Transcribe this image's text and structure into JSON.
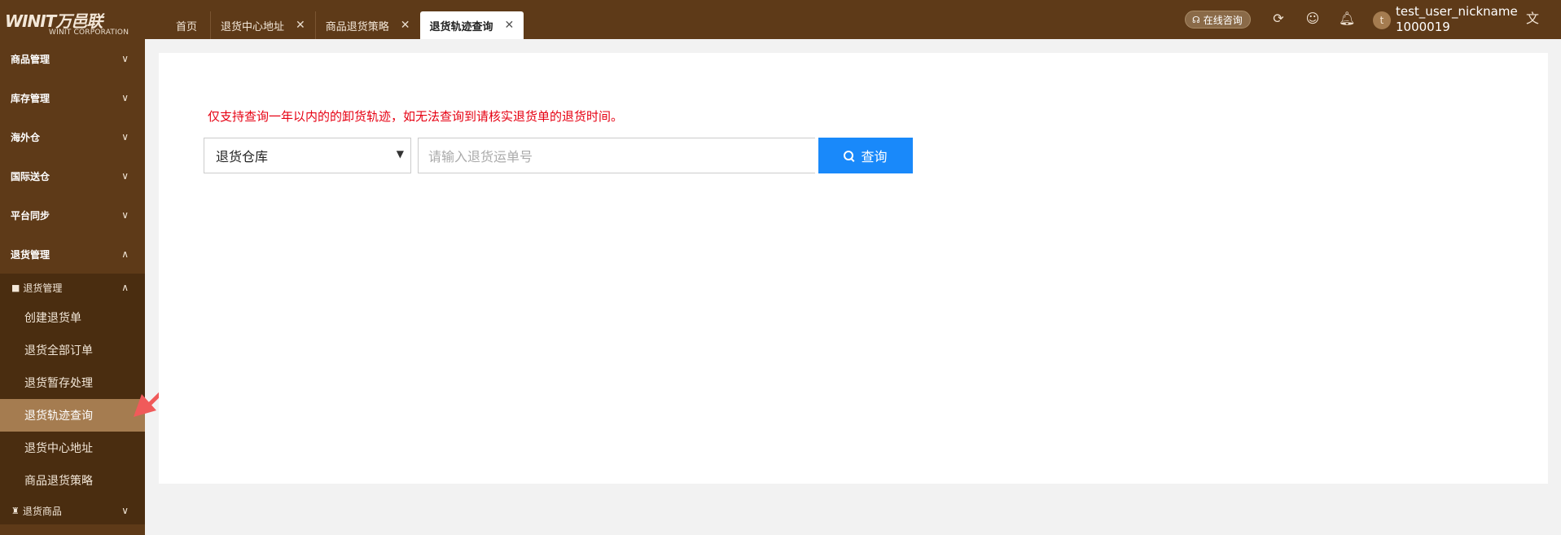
{
  "brand": {
    "logo_text": "WINIT万邑联",
    "logo_sub": "WINIT CORPORATION"
  },
  "tabs": [
    {
      "label": "首页",
      "closable": false,
      "active": false
    },
    {
      "label": "退货中心地址",
      "closable": true,
      "active": false
    },
    {
      "label": "商品退货策略",
      "closable": true,
      "active": false
    },
    {
      "label": "退货轨迹查询",
      "closable": true,
      "active": true
    }
  ],
  "header": {
    "consult_label": "在线咨询",
    "icons": [
      "refresh-icon",
      "feedback-icon",
      "bell-icon",
      "translate-icon"
    ],
    "user": {
      "avatar_letter": "t",
      "nickname": "test_user_nickname",
      "id": "1000019"
    }
  },
  "sidebar": {
    "menus": [
      {
        "label": "商品管理",
        "expanded": false
      },
      {
        "label": "库存管理",
        "expanded": false
      },
      {
        "label": "海外仓",
        "expanded": false
      },
      {
        "label": "国际送仓",
        "expanded": false
      },
      {
        "label": "平台同步",
        "expanded": false
      },
      {
        "label": "退货管理",
        "expanded": true
      }
    ],
    "return_group": {
      "label": "退货管理",
      "items": [
        {
          "label": "创建退货单",
          "active": false
        },
        {
          "label": "退货全部订单",
          "active": false
        },
        {
          "label": "退货暂存处理",
          "active": false
        },
        {
          "label": "退货轨迹查询",
          "active": true
        },
        {
          "label": "退货中心地址",
          "active": false
        },
        {
          "label": "商品退货策略",
          "active": false
        }
      ]
    },
    "return_goods_group": {
      "label": "退货商品"
    }
  },
  "main": {
    "notice": "仅支持查询一年以内的的卸货轨迹，如无法查询到请核实退货单的退货时间。",
    "warehouse_select": {
      "value": "退货仓库"
    },
    "tracking_input": {
      "placeholder": "请输入退货运单号",
      "value": ""
    },
    "search_button": "查询"
  },
  "colors": {
    "brand_brown": "#5e3a18",
    "submenu_brown": "#4a2d10",
    "active_item": "#a57c50",
    "primary_blue": "#1989fa",
    "notice_red": "#e60012"
  }
}
